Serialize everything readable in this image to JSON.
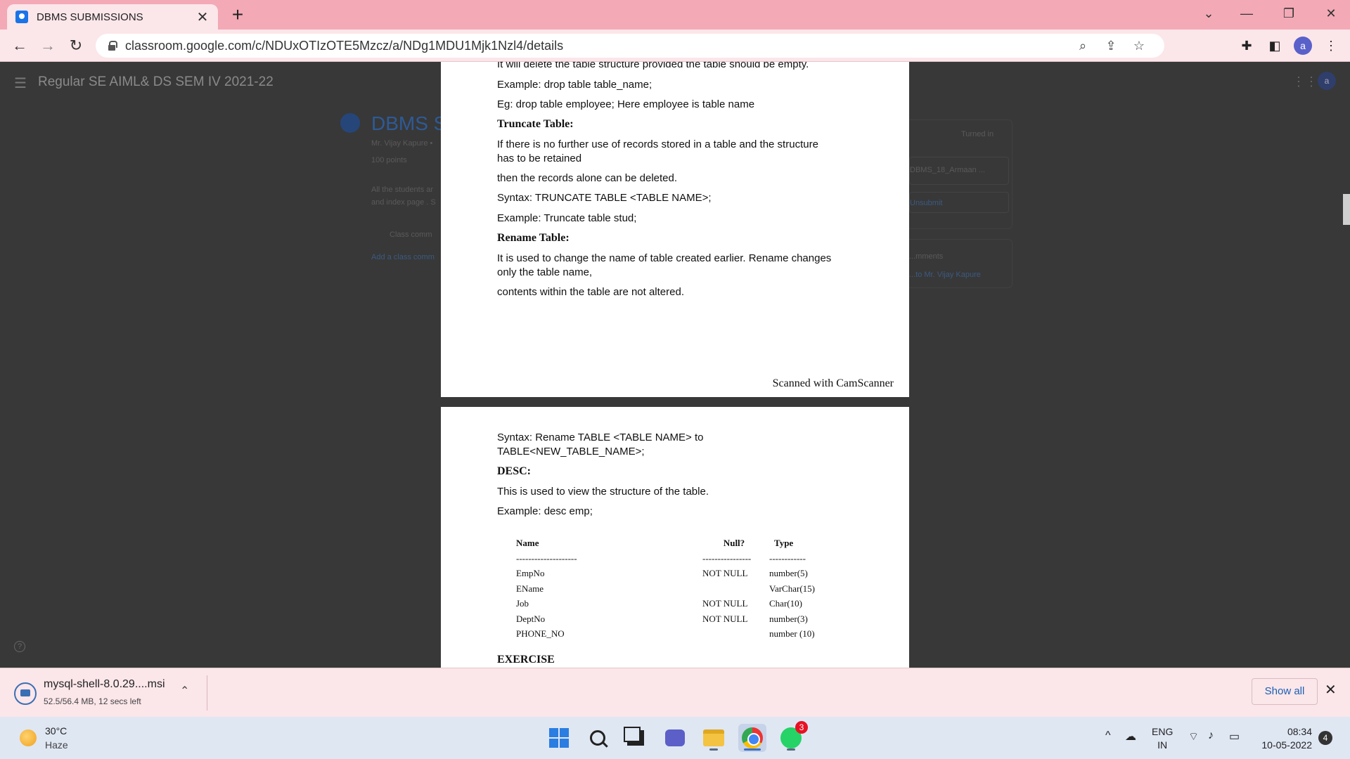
{
  "browser": {
    "tab_title": "DBMS SUBMISSIONS",
    "url": "classroom.google.com/c/NDUxOTIzOTE5Mzcz/a/NDg1MDU1Mjk1Nzl4/details",
    "profile_initial": "a"
  },
  "classroom": {
    "class_title": "Regular SE AIML& DS SEM IV 2021-22",
    "assignment_title": "DBMS SU",
    "teacher": "Mr. Vijay Kapure •",
    "points": "100 points",
    "desc_line1": "All the students ar",
    "desc_line2": "and index page . S",
    "class_comments": "Class comm",
    "add_comment": "Add a class comm",
    "turned_in": "Turned in",
    "file": "DBMS_18_Armaan ...",
    "unsubmit": "Unsubmit",
    "private_comments": "...mments",
    "private_to": "...to Mr. Vijay Kapure"
  },
  "document": {
    "page1": {
      "l1": "It will delete the table structure provided the table should be empty.",
      "l2": "Example: drop table table_name;",
      "l3": "Eg: drop table employee; Here employee is table name",
      "l4": "Truncate Table:",
      "l5": "If there is no further use of records stored in a table and the structure\nhas to be retained",
      "l6": "then the records alone can be deleted.",
      "l7": "Syntax: TRUNCATE TABLE <TABLE NAME>;",
      "l8": "Example: Truncate table stud;",
      "l9": "Rename Table:",
      "l10": "It is used to change the name of table created earlier. Rename changes\nonly the table name,",
      "l11": "contents within the table are not altered.",
      "watermark": "Scanned with CamScanner"
    },
    "page2": {
      "l1": "Syntax: Rename TABLE <TABLE NAME> to\nTABLE<NEW_TABLE_NAME>;",
      "l2": "DESC:",
      "l3": "This is used to view the structure of the table.",
      "l4": "Example: desc emp;",
      "table": {
        "headers": [
          "Name",
          "Null?",
          "Type"
        ],
        "dashes": [
          "--------------------",
          "----------------",
          "------------"
        ],
        "rows": [
          [
            "EmpNo",
            "NOT NULL",
            "number(5)"
          ],
          [
            "EName",
            "",
            "VarChar(15)"
          ],
          [
            "Job",
            "NOT NULL",
            "Char(10)"
          ],
          [
            "DeptNo",
            "NOT NULL",
            "number(3)"
          ],
          [
            "PHONE_NO",
            "",
            "number (10)"
          ]
        ]
      },
      "l5": "EXERCISE"
    }
  },
  "download": {
    "file": "mysql-shell-8.0.29....msi",
    "status": "52.5/56.4 MB, 12 secs left",
    "show_all": "Show all"
  },
  "taskbar": {
    "temp": "30°C",
    "weather": "Haze",
    "whatsapp_badge": "3",
    "lang1": "ENG",
    "lang2": "IN",
    "time": "08:34",
    "date": "10-05-2022",
    "notifications": "4"
  }
}
